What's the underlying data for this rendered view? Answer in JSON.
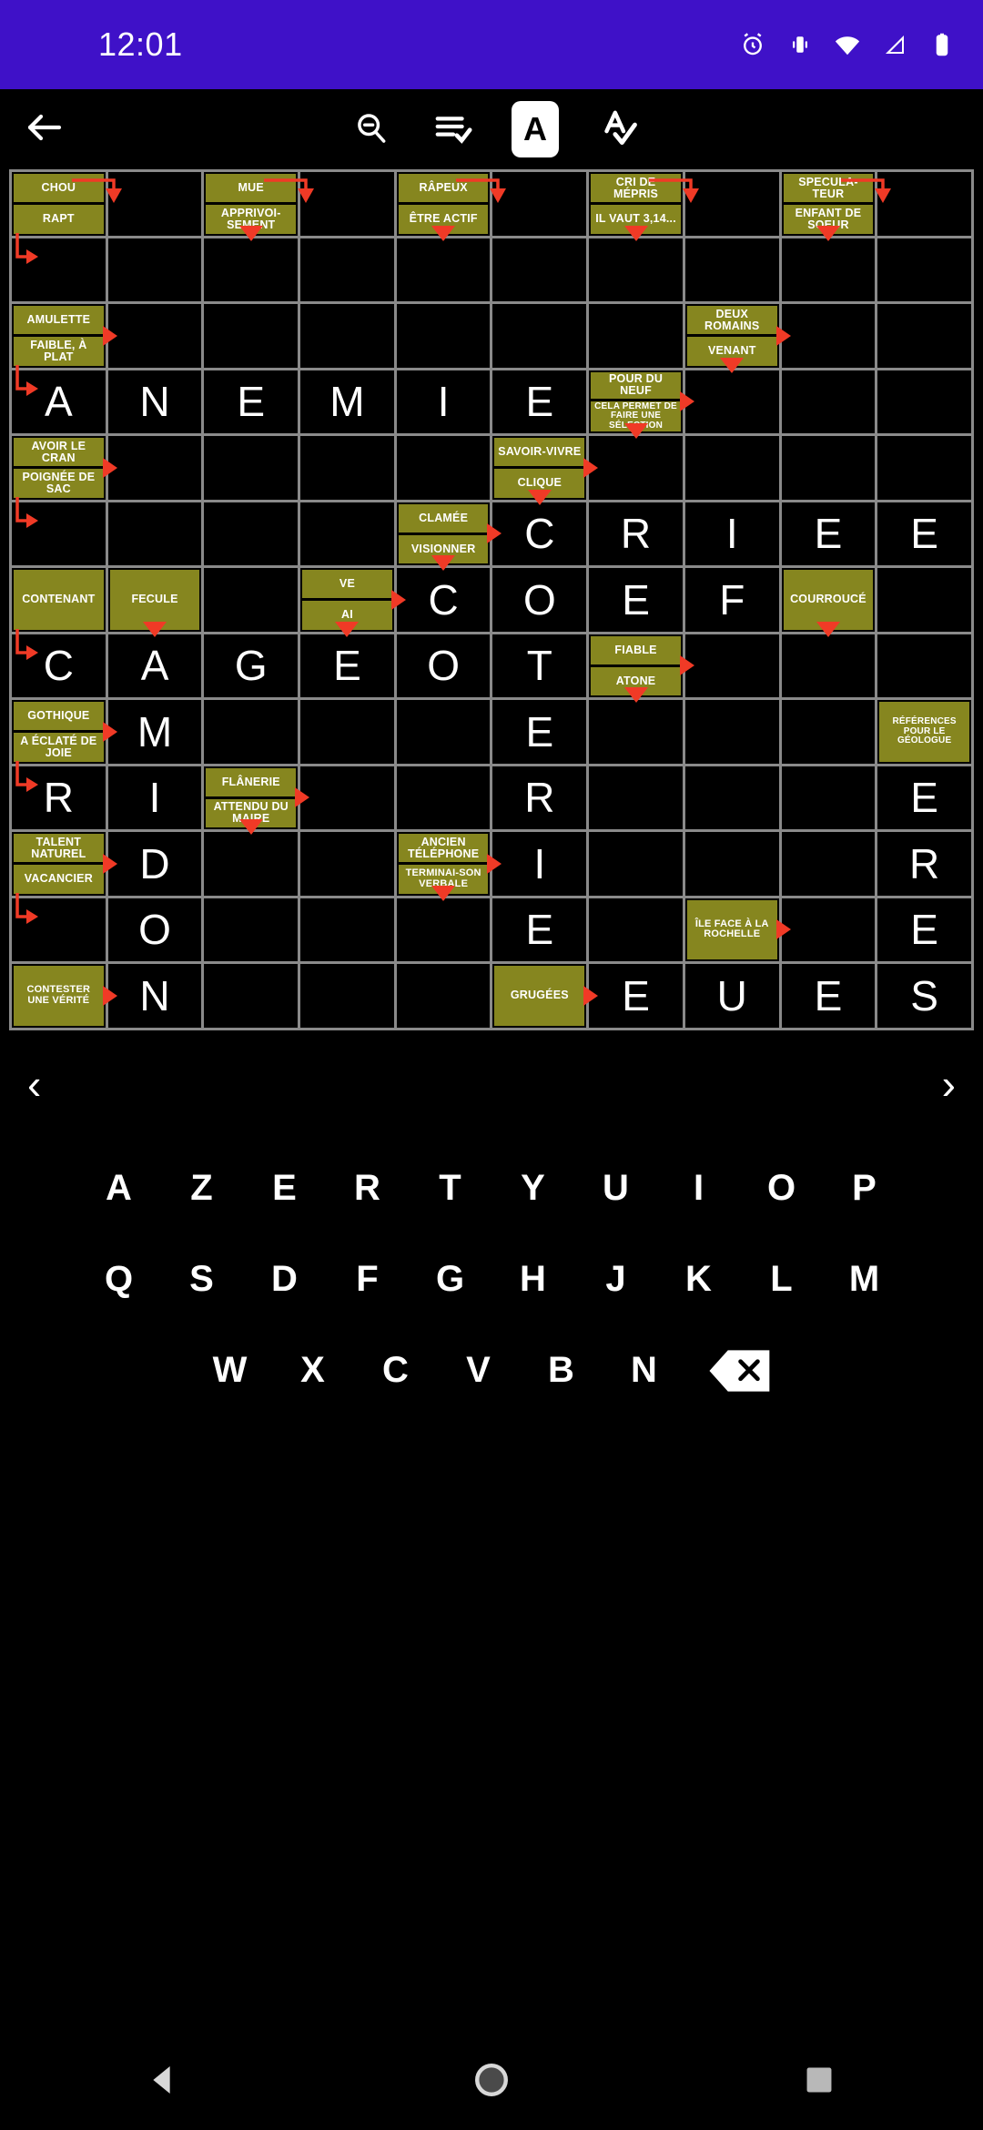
{
  "status_bar": {
    "time": "12:01",
    "icons": [
      "alarm-icon",
      "vibrate-icon",
      "wifi-icon",
      "signal-icon",
      "battery-icon"
    ],
    "background": "#3f11c8"
  },
  "toolbar": {
    "back_label": "back-arrow",
    "items": [
      {
        "name": "zoom-out-button",
        "icon": "magnifier-minus-icon"
      },
      {
        "name": "list-check-button",
        "icon": "list-check-icon"
      },
      {
        "name": "letter-mode-button",
        "icon": "letter-a-icon",
        "label": "A",
        "selected": true
      },
      {
        "name": "check-letter-button",
        "icon": "letter-a-check-icon",
        "label": "A"
      }
    ]
  },
  "grid": {
    "columns": 10,
    "rows": 13,
    "clue_color": "#86861f",
    "cell_color": "#000000",
    "border_color": "#8a8a8a",
    "arrow_color": "#f03a26",
    "cells": [
      {
        "r": 0,
        "c": 0,
        "clues": [
          "CHOU",
          "RAPT"
        ]
      },
      {
        "r": 0,
        "c": 1,
        "arrow": "corner"
      },
      {
        "r": 0,
        "c": 2,
        "clues": [
          "MUE",
          "APPRIVOI-SEMENT"
        ]
      },
      {
        "r": 0,
        "c": 3,
        "arrow": "corner"
      },
      {
        "r": 0,
        "c": 4,
        "clues": [
          "RÂPEUX",
          "ÊTRE ACTIF"
        ]
      },
      {
        "r": 0,
        "c": 5,
        "arrow": "corner"
      },
      {
        "r": 0,
        "c": 6,
        "clues": [
          "CRI DE MÉPRIS",
          "IL VAUT 3,14..."
        ]
      },
      {
        "r": 0,
        "c": 7,
        "arrow": "corner"
      },
      {
        "r": 0,
        "c": 8,
        "clues": [
          "SPECULA-TEUR",
          "ENFANT DE SOEUR"
        ]
      },
      {
        "r": 0,
        "c": 9,
        "arrow": "corner"
      },
      {
        "r": 1,
        "c": 0,
        "arrow": "elbow"
      },
      {
        "r": 1,
        "c": 2,
        "arrow": "down"
      },
      {
        "r": 1,
        "c": 4,
        "arrow": "down"
      },
      {
        "r": 1,
        "c": 6,
        "arrow": "down"
      },
      {
        "r": 1,
        "c": 8,
        "arrow": "down"
      },
      {
        "r": 2,
        "c": 0,
        "clues": [
          "AMULETTE",
          "FAIBLE, À PLAT"
        ],
        "arrow": "right"
      },
      {
        "r": 2,
        "c": 7,
        "clues": [
          "DEUX ROMAINS",
          "VENANT"
        ],
        "arrow": "right"
      },
      {
        "r": 3,
        "c": 0,
        "letter": "A",
        "arrow": "elbow"
      },
      {
        "r": 3,
        "c": 1,
        "letter": "N"
      },
      {
        "r": 3,
        "c": 2,
        "letter": "E"
      },
      {
        "r": 3,
        "c": 3,
        "letter": "M"
      },
      {
        "r": 3,
        "c": 4,
        "letter": "I"
      },
      {
        "r": 3,
        "c": 5,
        "letter": "E"
      },
      {
        "r": 3,
        "c": 6,
        "clues": [
          "POUR DU NEUF",
          "CELA PERMET DE FAIRE UNE SÉLECTION"
        ],
        "arrow": "right"
      },
      {
        "r": 3,
        "c": 7,
        "arrow": "down"
      },
      {
        "r": 4,
        "c": 0,
        "clues": [
          "AVOIR LE CRAN",
          "POIGNÉE DE SAC"
        ],
        "arrow": "right"
      },
      {
        "r": 4,
        "c": 5,
        "clues": [
          "SAVOIR-VIVRE",
          "CLIQUE"
        ],
        "arrow": "right"
      },
      {
        "r": 4,
        "c": 6,
        "arrow": "down"
      },
      {
        "r": 5,
        "c": 0,
        "arrow": "elbow"
      },
      {
        "r": 5,
        "c": 4,
        "clues": [
          "CLAMÉE",
          "VISIONNER"
        ],
        "arrow": "right"
      },
      {
        "r": 5,
        "c": 5,
        "letter": "C",
        "arrow": "down"
      },
      {
        "r": 5,
        "c": 6,
        "letter": "R"
      },
      {
        "r": 5,
        "c": 7,
        "letter": "I"
      },
      {
        "r": 5,
        "c": 8,
        "letter": "E"
      },
      {
        "r": 5,
        "c": 9,
        "letter": "E"
      },
      {
        "r": 6,
        "c": 0,
        "clues": [
          "CONTENANT"
        ]
      },
      {
        "r": 6,
        "c": 1,
        "clues": [
          "FECULE"
        ]
      },
      {
        "r": 6,
        "c": 3,
        "clues": [
          "VE",
          "AI"
        ],
        "arrow": "right"
      },
      {
        "r": 6,
        "c": 4,
        "letter": "C",
        "arrow": "down"
      },
      {
        "r": 6,
        "c": 5,
        "letter": "O"
      },
      {
        "r": 6,
        "c": 6,
        "letter": "E"
      },
      {
        "r": 6,
        "c": 7,
        "letter": "F"
      },
      {
        "r": 6,
        "c": 8,
        "clues": [
          "COURROUCÉ"
        ]
      },
      {
        "r": 7,
        "c": 0,
        "letter": "C",
        "arrow": "elbow"
      },
      {
        "r": 7,
        "c": 1,
        "letter": "A",
        "arrow": "down"
      },
      {
        "r": 7,
        "c": 2,
        "letter": "G"
      },
      {
        "r": 7,
        "c": 3,
        "letter": "E",
        "arrow": "down"
      },
      {
        "r": 7,
        "c": 4,
        "letter": "O"
      },
      {
        "r": 7,
        "c": 5,
        "letter": "T"
      },
      {
        "r": 7,
        "c": 6,
        "clues": [
          "FIABLE",
          "ATONE"
        ],
        "arrow": "right"
      },
      {
        "r": 7,
        "c": 8,
        "arrow": "down"
      },
      {
        "r": 8,
        "c": 0,
        "clues": [
          "GOTHIQUE",
          "A ÉCLATÉ DE JOIE"
        ],
        "arrow": "right"
      },
      {
        "r": 8,
        "c": 1,
        "letter": "M"
      },
      {
        "r": 8,
        "c": 5,
        "letter": "E"
      },
      {
        "r": 8,
        "c": 6,
        "arrow": "down"
      },
      {
        "r": 8,
        "c": 9,
        "clues": [
          "RÉFÉRENCES POUR LE GÉOLOGUE"
        ]
      },
      {
        "r": 9,
        "c": 0,
        "letter": "R",
        "arrow": "elbow"
      },
      {
        "r": 9,
        "c": 1,
        "letter": "I"
      },
      {
        "r": 9,
        "c": 2,
        "clues": [
          "FLÂNERIE",
          "ATTENDU DU MAIRE"
        ],
        "arrow": "right"
      },
      {
        "r": 9,
        "c": 5,
        "letter": "R"
      },
      {
        "r": 9,
        "c": 9,
        "letter": "E"
      },
      {
        "r": 10,
        "c": 0,
        "clues": [
          "TALENT NATUREL",
          "VACANCIER"
        ],
        "arrow": "right"
      },
      {
        "r": 10,
        "c": 1,
        "letter": "D"
      },
      {
        "r": 10,
        "c": 2,
        "arrow": "down"
      },
      {
        "r": 10,
        "c": 4,
        "clues": [
          "ANCIEN TÉLÉPHONE",
          "TERMINAI-SON VERBALE"
        ],
        "arrow": "right"
      },
      {
        "r": 10,
        "c": 5,
        "letter": "I"
      },
      {
        "r": 10,
        "c": 9,
        "letter": "R"
      },
      {
        "r": 11,
        "c": 0,
        "arrow": "elbow"
      },
      {
        "r": 11,
        "c": 1,
        "letter": "O"
      },
      {
        "r": 11,
        "c": 4,
        "arrow": "down"
      },
      {
        "r": 11,
        "c": 5,
        "letter": "E"
      },
      {
        "r": 11,
        "c": 7,
        "clues": [
          "ÎLE FACE À LA ROCHELLE"
        ],
        "arrow": "right"
      },
      {
        "r": 11,
        "c": 9,
        "letter": "E"
      },
      {
        "r": 12,
        "c": 0,
        "clues": [
          "CONTESTER UNE VÉRITÉ"
        ],
        "arrow": "right"
      },
      {
        "r": 12,
        "c": 1,
        "letter": "N"
      },
      {
        "r": 12,
        "c": 5,
        "clues": [
          "GRUGÉES"
        ],
        "arrow": "right"
      },
      {
        "r": 12,
        "c": 6,
        "letter": "E"
      },
      {
        "r": 12,
        "c": 7,
        "letter": "U"
      },
      {
        "r": 12,
        "c": 8,
        "letter": "E"
      },
      {
        "r": 12,
        "c": 9,
        "letter": "S"
      }
    ]
  },
  "pager": {
    "prev_label": "‹",
    "next_label": "›"
  },
  "keyboard": {
    "rows": [
      [
        "A",
        "Z",
        "E",
        "R",
        "T",
        "Y",
        "U",
        "I",
        "O",
        "P"
      ],
      [
        "Q",
        "S",
        "D",
        "F",
        "G",
        "H",
        "J",
        "K",
        "L",
        "M"
      ],
      [
        "W",
        "X",
        "C",
        "V",
        "B",
        "N"
      ]
    ],
    "backspace": "backspace-key"
  },
  "navbar": {
    "back": "triangle-back-icon",
    "home": "circle-home-icon",
    "recents": "square-recents-icon"
  }
}
